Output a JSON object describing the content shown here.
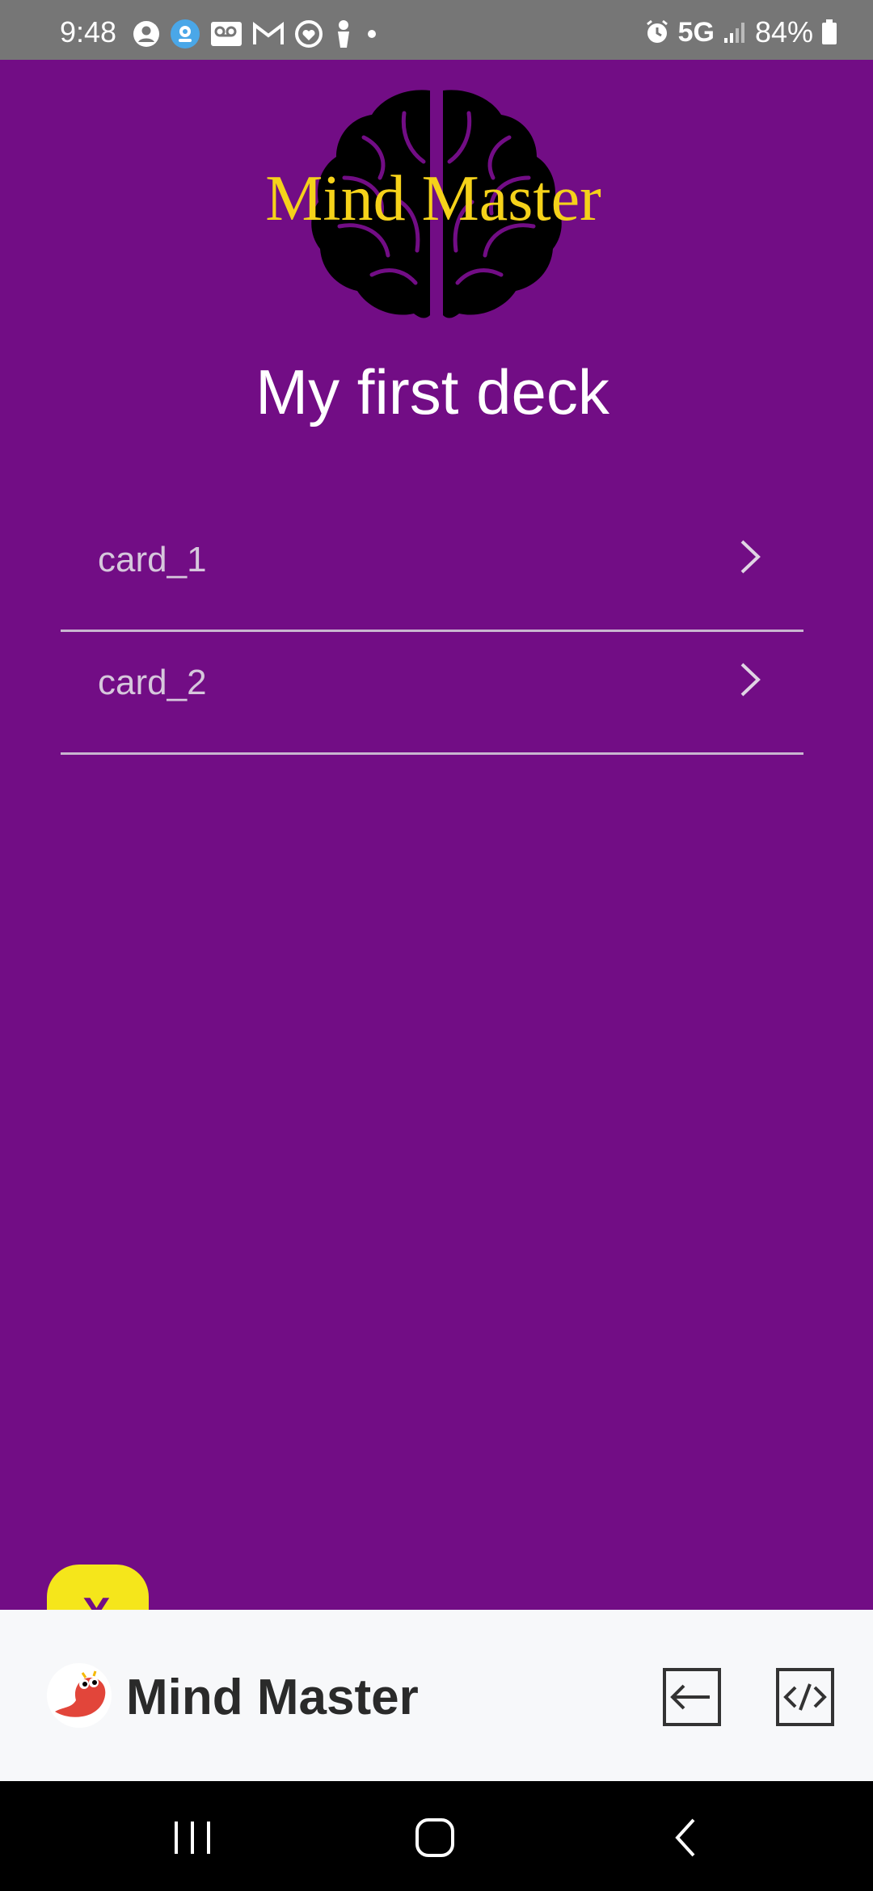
{
  "status_bar": {
    "time": "9:48",
    "network": "5G",
    "battery": "84%",
    "icons": [
      "person-circle-icon",
      "location-icon",
      "voicemail-icon",
      "gmail-icon",
      "heart-icon",
      "figure-icon",
      "dot-icon",
      "alarm-icon",
      "signal-icon",
      "battery-icon"
    ]
  },
  "app": {
    "logo_text": "Mind Master",
    "deck_title": "My first deck",
    "cards": [
      {
        "label": "card_1"
      },
      {
        "label": "card_2"
      }
    ],
    "fab_label": "X"
  },
  "bottom_bar": {
    "title": "Mind Master"
  },
  "colors": {
    "background": "#720d85",
    "logo_text": "#f5d21a",
    "fab": "#f5e61b"
  }
}
